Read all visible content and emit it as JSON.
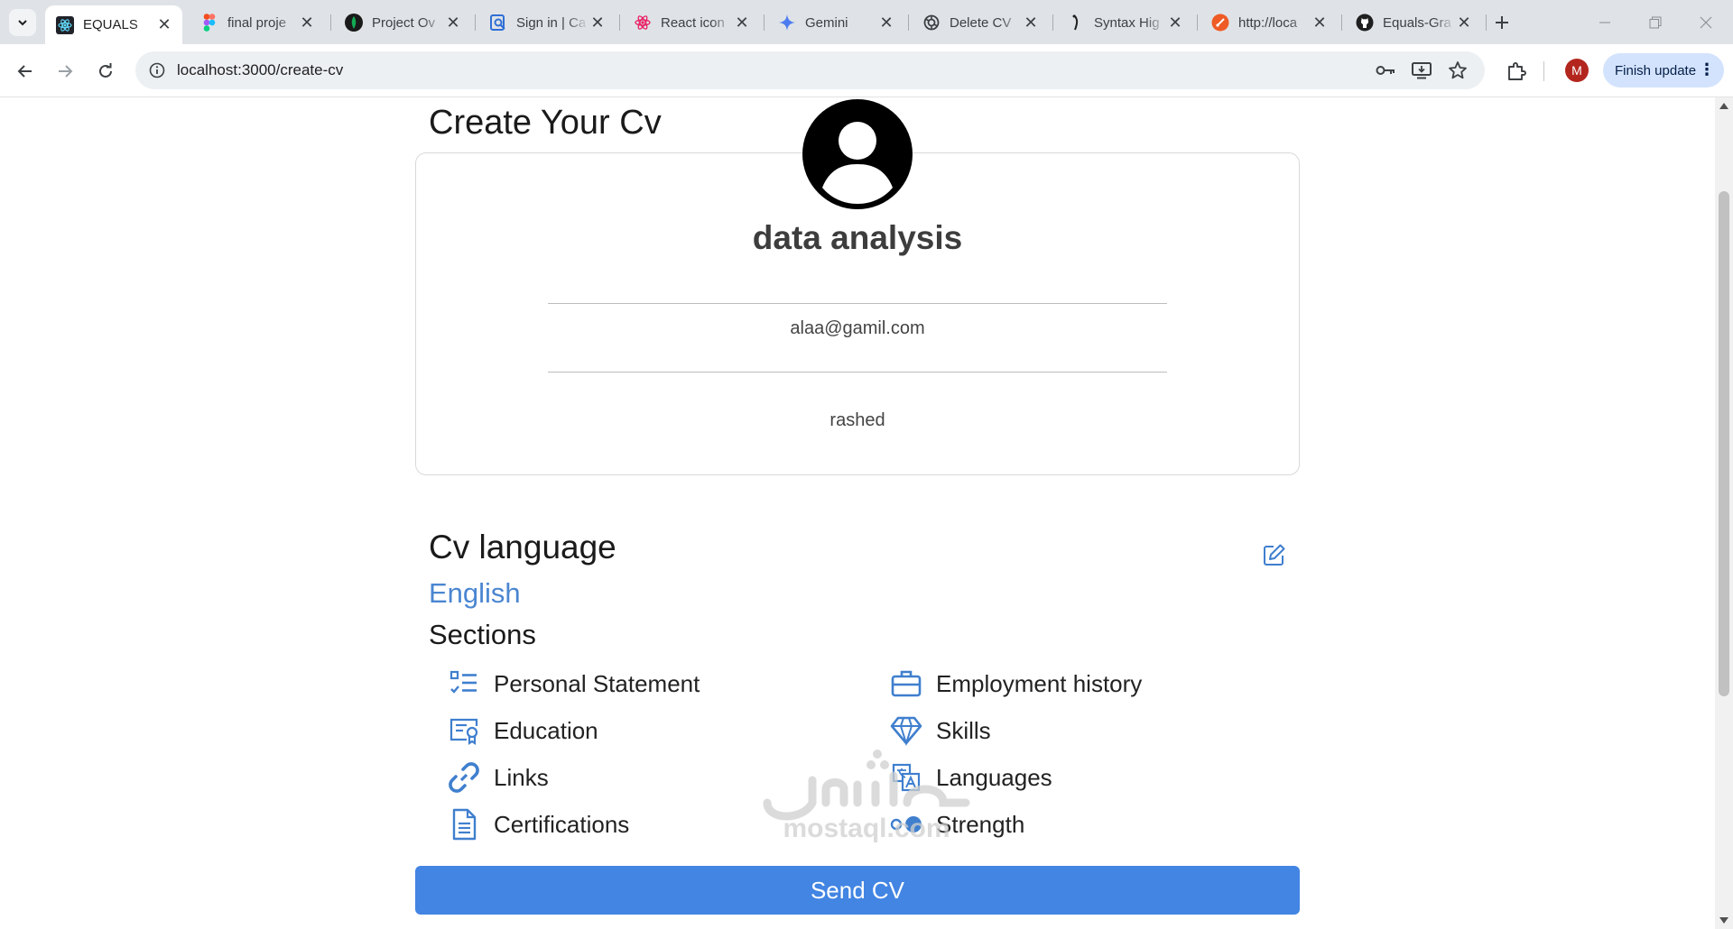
{
  "browser": {
    "tabs": [
      {
        "title": "EQUALS",
        "icon": "react-icon",
        "active": true
      },
      {
        "title": "final proje",
        "icon": "figma-icon"
      },
      {
        "title": "Project Ov",
        "icon": "mongodb-icon"
      },
      {
        "title": "Sign in | Ca",
        "icon": "search-doc-icon"
      },
      {
        "title": "React icon",
        "icon": "react-pink-icon"
      },
      {
        "title": "Gemini",
        "icon": "gemini-icon"
      },
      {
        "title": "Delete CV",
        "icon": "openai-icon"
      },
      {
        "title": "Syntax Hig",
        "icon": "syntax-icon"
      },
      {
        "title": "http://loca",
        "icon": "postman-icon"
      },
      {
        "title": "Equals-Gra",
        "icon": "github-icon"
      }
    ],
    "url": "localhost:3000/create-cv",
    "profile_initial": "M",
    "finish_update_label": "Finish update"
  },
  "page": {
    "title": "Create Your Cv",
    "profile": {
      "name": "data analysis",
      "email": "alaa@gamil.com",
      "last_name": "rashed"
    },
    "cv_language_title": "Cv language",
    "cv_language_value": "English",
    "sections_title": "Sections",
    "sections": {
      "personal_statement": "Personal Statement",
      "employment_history": "Employment history",
      "education": "Education",
      "skills": "Skills",
      "links": "Links",
      "languages": "Languages",
      "certifications": "Certifications",
      "strength": "Strength"
    },
    "send_label": "Send CV",
    "accent_color": "#4285e3",
    "icon_color": "#3f7fce"
  }
}
